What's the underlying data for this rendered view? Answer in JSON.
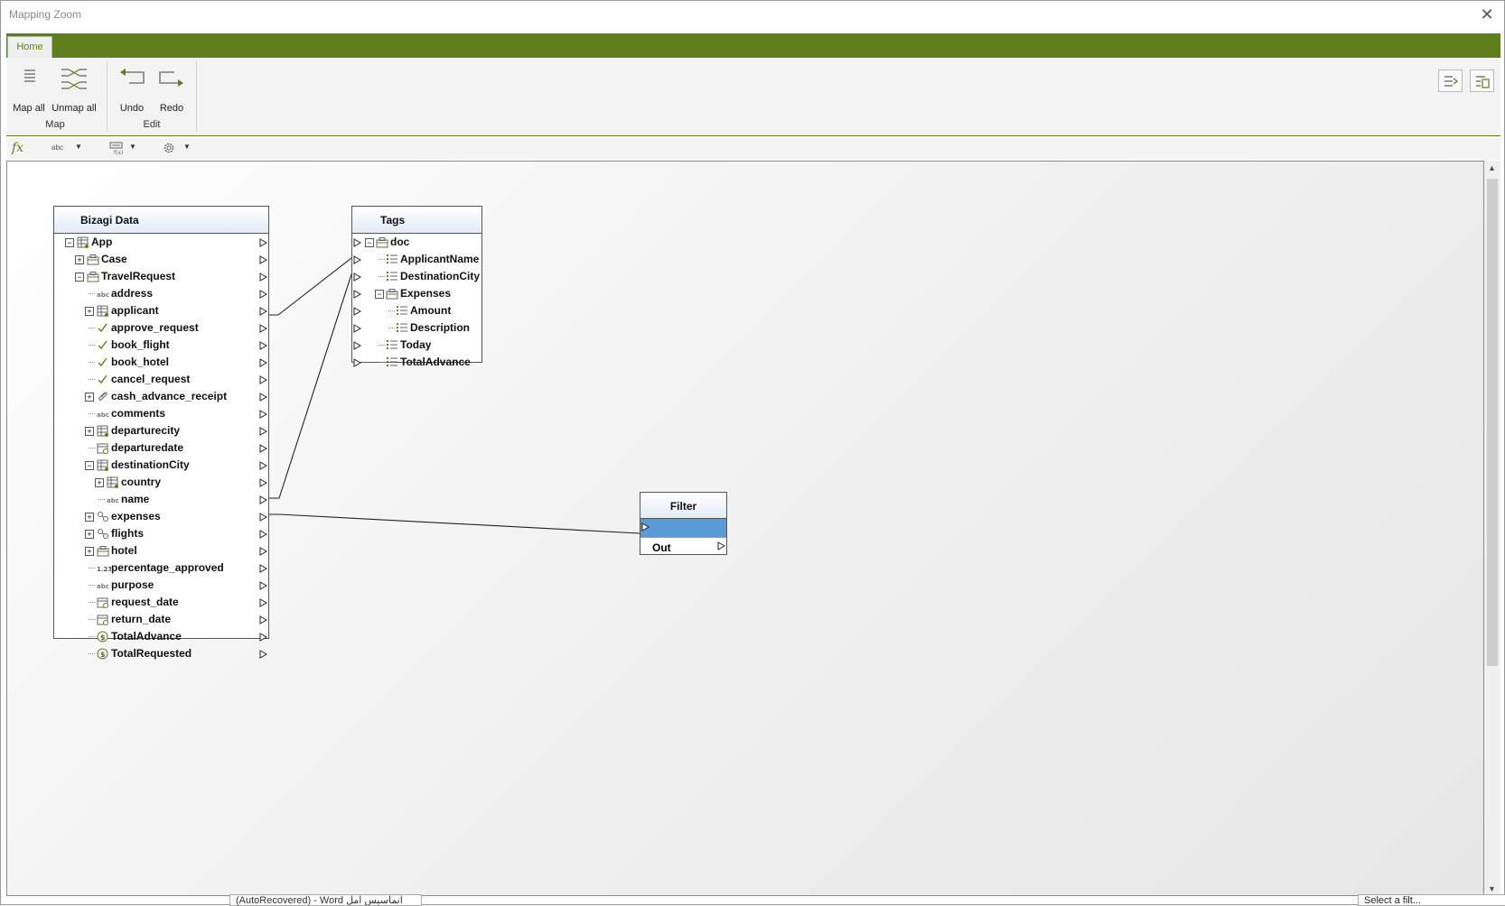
{
  "window": {
    "title": "Mapping Zoom",
    "close_glyph": "✕"
  },
  "tabs": [
    {
      "label": "Home"
    }
  ],
  "ribbon": {
    "map_all": "Map all",
    "unmap_all": "Unmap all",
    "undo": "Undo",
    "redo": "Redo",
    "group_map": "Map",
    "group_edit": "Edit"
  },
  "toolbar": {
    "fx": "fx",
    "abc": "abc"
  },
  "bizagi": {
    "title": "Bizagi Data",
    "rows": [
      {
        "label": "App",
        "icon": "table-icon"
      },
      {
        "label": "Case",
        "icon": "briefcase-icon"
      },
      {
        "label": "TravelRequest",
        "icon": "briefcase-icon"
      },
      {
        "label": "address",
        "icon": "abc-icon"
      },
      {
        "label": "applicant",
        "icon": "table-icon"
      },
      {
        "label": "approve_request",
        "icon": "check-icon"
      },
      {
        "label": "book_flight",
        "icon": "check-icon"
      },
      {
        "label": "book_hotel",
        "icon": "check-icon"
      },
      {
        "label": "cancel_request",
        "icon": "check-icon"
      },
      {
        "label": "cash_advance_receipt",
        "icon": "paperclip-icon"
      },
      {
        "label": "comments",
        "icon": "abc-icon"
      },
      {
        "label": "departurecity",
        "icon": "table-icon"
      },
      {
        "label": "departuredate",
        "icon": "calendar-icon"
      },
      {
        "label": "destinationCity",
        "icon": "table-icon"
      },
      {
        "label": "country",
        "icon": "table-icon"
      },
      {
        "label": "name",
        "icon": "abc-icon"
      },
      {
        "label": "expenses",
        "icon": "collection-icon"
      },
      {
        "label": "flights",
        "icon": "collection-icon"
      },
      {
        "label": "hotel",
        "icon": "briefcase-icon"
      },
      {
        "label": "percentage_approved",
        "icon": "number-icon"
      },
      {
        "label": "purpose",
        "icon": "abc-icon"
      },
      {
        "label": "request_date",
        "icon": "calendar-icon"
      },
      {
        "label": "return_date",
        "icon": "calendar-icon"
      },
      {
        "label": "TotalAdvance",
        "icon": "currency-icon"
      },
      {
        "label": "TotalRequested",
        "icon": "currency-icon"
      }
    ]
  },
  "tags": {
    "title": "Tags",
    "rows": [
      {
        "label": "doc",
        "icon": "briefcase-icon"
      },
      {
        "label": "ApplicantName",
        "icon": "list-icon"
      },
      {
        "label": "DestinationCity",
        "icon": "list-icon"
      },
      {
        "label": "Expenses",
        "icon": "briefcase-icon"
      },
      {
        "label": "Amount",
        "icon": "list-icon"
      },
      {
        "label": "Description",
        "icon": "list-icon"
      },
      {
        "label": "Today",
        "icon": "list-icon"
      },
      {
        "label": "TotalAdvance",
        "icon": "list-icon"
      }
    ]
  },
  "filter": {
    "title": "Filter",
    "out": "Out"
  },
  "peek": {
    "word": "(AutoRecovered) - Word  انماسيس امل",
    "tooltip": "Select a filt..."
  },
  "colors": {
    "accent": "#5e7f1c",
    "selection": "#5b9bd5"
  }
}
